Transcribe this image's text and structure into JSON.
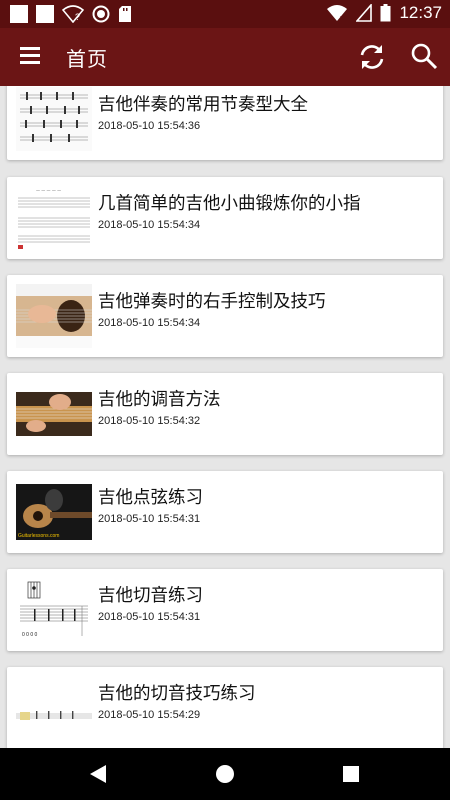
{
  "status_bar": {
    "time": "12:37",
    "icons": [
      "notification-square-icon",
      "notification-square-icon",
      "wifi-unknown-icon",
      "record-icon",
      "sd-card-icon",
      "wifi-icon",
      "signal-icon",
      "battery-icon"
    ]
  },
  "app_bar": {
    "title": "首页",
    "icons": [
      "menu-icon",
      "refresh-icon",
      "search-icon"
    ]
  },
  "colors": {
    "status_bar": "#5a0f0f",
    "app_bar": "#6b1515",
    "background": "#e6e6e6"
  },
  "articles": [
    {
      "title": "吉他伴奏的常用节奏型大全",
      "time": "2018-05-10 15:54:36"
    },
    {
      "title": "几首简单的吉他小曲锻炼你的小指",
      "time": "2018-05-10 15:54:34"
    },
    {
      "title": "吉他弹奏时的右手控制及技巧",
      "time": "2018-05-10 15:54:34"
    },
    {
      "title": "吉他的调音方法",
      "time": "2018-05-10 15:54:32"
    },
    {
      "title": "吉他点弦练习",
      "time": "2018-05-10 15:54:31"
    },
    {
      "title": "吉他切音练习",
      "time": "2018-05-10 15:54:31"
    },
    {
      "title": "吉他的切音技巧练习",
      "time": "2018-05-10 15:54:29"
    }
  ],
  "nav_bar": {
    "icons": [
      "back-icon",
      "home-icon",
      "recent-apps-icon"
    ]
  }
}
